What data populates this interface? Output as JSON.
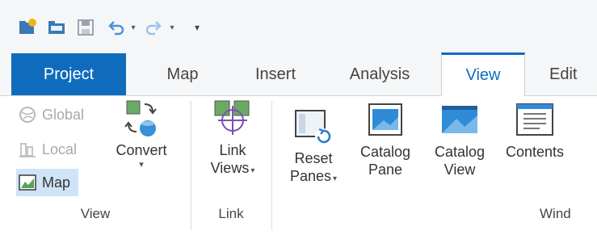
{
  "quick_access": {
    "customize_glyph": "▾"
  },
  "tabs": [
    {
      "label": "Project"
    },
    {
      "label": "Map"
    },
    {
      "label": "Insert"
    },
    {
      "label": "Analysis"
    },
    {
      "label": "View"
    },
    {
      "label": "Edit"
    }
  ],
  "view_group": {
    "label": "View",
    "global_label": "Global",
    "local_label": "Local",
    "map_label": "Map",
    "convert_label": "Convert"
  },
  "link_group": {
    "label": "Link",
    "link_views_line1": "Link",
    "link_views_line2": "Views"
  },
  "windows_group": {
    "label": "Wind",
    "reset_panes_line1": "Reset",
    "reset_panes_line2": "Panes",
    "catalog_pane_line1": "Catalog",
    "catalog_pane_line2": "Pane",
    "catalog_view_line1": "Catalog",
    "catalog_view_line2": "View",
    "contents_label": "Contents"
  },
  "colors": {
    "accent": "#0f6cbd",
    "selected": "#cfe4f6"
  }
}
